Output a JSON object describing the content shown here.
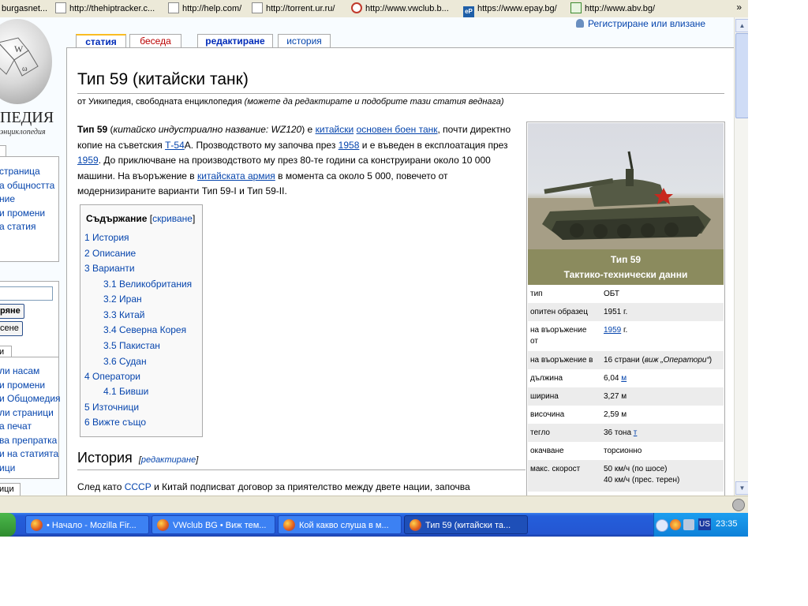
{
  "bookmarks": [
    {
      "label": "burgasnet...",
      "icon": "page-icon"
    },
    {
      "label": "http://thehiptracker.c...",
      "icon": "page-icon"
    },
    {
      "label": "http://help.com/",
      "icon": "page-icon"
    },
    {
      "label": "http://torrent.ur.ru/",
      "icon": "page-icon"
    },
    {
      "label": "http://www.vwclub.b...",
      "icon": "vw-icon"
    },
    {
      "label": "https://www.epay.bg/",
      "icon": "epay-icon"
    },
    {
      "label": "http://www.abv.bg/",
      "icon": "home-icon"
    }
  ],
  "bookmarks_more": "»",
  "wiki": {
    "logo_text": "ПЕДИЯ",
    "logo_sub": "энциклопедия",
    "user_link": "Регистриране или влизане",
    "tabs": [
      "статия",
      "беседа",
      "редактиране",
      "история"
    ],
    "title": "Тип 59 (китайски танк)",
    "site_sub": "от Уикипедия, свободната енциклопедия",
    "site_sub_italic": "(можете да редактирате и подобрите тази статия веднага)",
    "intro": {
      "bold": "Тип 59",
      "p1": " (",
      "italic": "китайско индустриално название: WZ120",
      "p2": ") е ",
      "link1": "китайски",
      "p3": " ",
      "link2": "основен боен танк",
      "p4": ", почти директно копие на съветския ",
      "link3": "Т-54",
      "p5": "А. Прозводството му започва през ",
      "link4": "1958",
      "p6": " и е въведен в експлоатация през ",
      "link5": "1959",
      "p7": ". До приключване на производството му през 80-те години са конструирани около 10 000 машини. На въоръжение в ",
      "link6": "китайската армия",
      "p8": " в момента са около 5 000, повечето от модернизираните варианти Тип 59-I и Тип 59-II."
    },
    "sidebar": {
      "nav": [
        "страница",
        "а общността",
        "ние",
        "и промени",
        "а статия"
      ],
      "buttons": [
        "ряне",
        "сене"
      ],
      "tools_tab": "и",
      "tools": [
        "ли насам",
        "и промени",
        "и Общомедия",
        "ли страници",
        "а печат",
        "ва препратка",
        "и на статията",
        "ици"
      ],
      "lang_tab": "ици"
    },
    "toc": {
      "title": "Съдържание",
      "hide_open": "[",
      "hide_link": "скриване",
      "hide_close": "]",
      "items": [
        "1 История",
        "2 Описание",
        "3 Варианти",
        "3.1 Великобритания",
        "3.2 Иран",
        "3.3 Китай",
        "3.4 Северна Корея",
        "3.5 Пакистан",
        "3.6 Судан",
        "4 Оператори",
        "4.1 Бивши",
        "5 Източници",
        "6 Вижте също"
      ]
    },
    "history": {
      "heading": "История",
      "edit_open": "[",
      "edit_link": "редактиране",
      "edit_close": "]",
      "t1": "След като ",
      "link": "СССР",
      "t2": " и Китай подписват договор за приятелство между двете нации, започва"
    },
    "infobox": {
      "name": "Тип 59",
      "subtitle": "Тактико-технически данни",
      "rows": [
        {
          "k": "тип",
          "v": "ОБТ"
        },
        {
          "k": "опитен образец",
          "v": "1951 г."
        },
        {
          "k": "на въоръжение от",
          "v": "",
          "link": "1959",
          "after": " г."
        },
        {
          "k": "на въоръжение в",
          "v": "16 страни (",
          "ital": "виж „Оператори“",
          "after": ")"
        },
        {
          "k": "дължина",
          "v": "6,04 ",
          "link": "м"
        },
        {
          "k": "ширина",
          "v": "3,27 м"
        },
        {
          "k": "височина",
          "v": "2,59 м"
        },
        {
          "k": "тегло",
          "v": "36 тона ",
          "link": "т"
        },
        {
          "k": "окачване",
          "v": "торсионно"
        },
        {
          "k": "макс. скорост",
          "v": "50 км/ч (по шосе)",
          "v2": "40 км/ч (прес. терен)"
        }
      ]
    }
  },
  "taskbar": {
    "tasks": [
      "• Начало - Mozilla Fir...",
      "VWclub BG • Виж тем...",
      "Кой какво слуша в м...",
      "Тип 59 (китайски та..."
    ],
    "lang": "US",
    "clock": "23:35"
  }
}
